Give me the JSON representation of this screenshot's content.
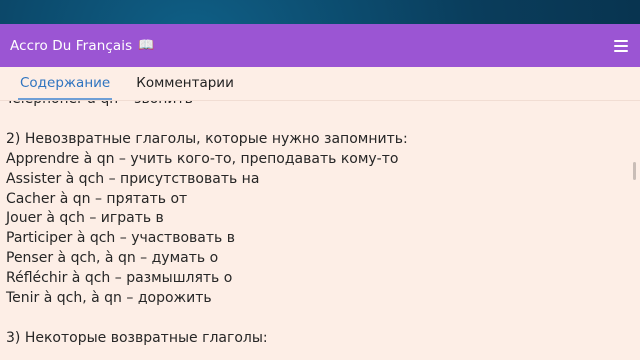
{
  "app": {
    "title": "Accro Du Français",
    "title_icon": "open-book-icon"
  },
  "colors": {
    "appbar": "#9b55d3",
    "content_bg": "#fdeee6",
    "active_tab": "#2f74c0"
  },
  "tabs": [
    {
      "label": "Содержание",
      "active": true
    },
    {
      "label": "Комментарии",
      "active": false
    }
  ],
  "lines": [
    "Téléphoner à qn – звонить",
    "",
    "2) Невозвратные глаголы, которые нужно запомнить:",
    "Apprendre à qn – учить кого-то, преподавать кому-то",
    "Assister à qch – присутствовать на",
    "Cacher à qn – прятать от",
    "Jouer à qch – играть в",
    "Participer à qch – участвовать в",
    "Penser à qch, à qn – думать о",
    "Réfléchir à qch – размышлять о",
    "Tenir à qch, à qn – дорожить",
    "",
    "3) Некоторые возвратные глаголы:"
  ]
}
